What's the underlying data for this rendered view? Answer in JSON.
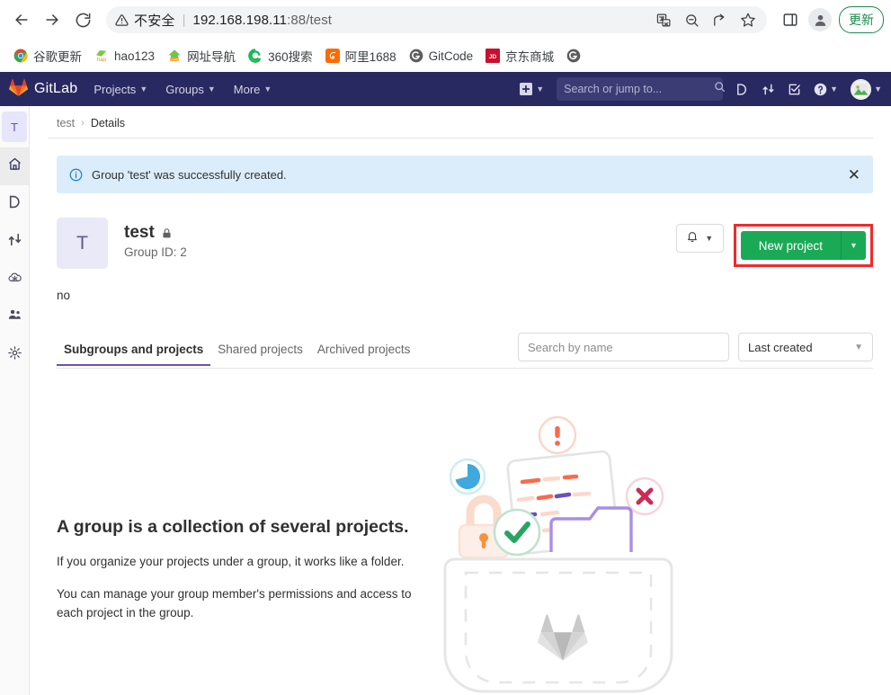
{
  "browser": {
    "nav": {
      "back_icon": "arrow-left-icon",
      "forward_icon": "arrow-right-icon",
      "reload_icon": "reload-icon"
    },
    "omnibox": {
      "warning_label": "不安全",
      "separator": "|",
      "url_host": "192.168.198.11",
      "url_rest": ":88/test",
      "translate_icon": "translate-icon",
      "zoom_icon": "zoom-out-icon",
      "share_icon": "share-icon",
      "bookmark_icon": "star-icon"
    },
    "side_panel_icon": "side-panel-icon",
    "profile_icon": "profile-avatar-icon",
    "update_button": "更新",
    "bookmarks": [
      {
        "label": "谷歌更新",
        "icon": "chrome-icon"
      },
      {
        "label": "hao123",
        "icon": "hao123-icon"
      },
      {
        "label": "网址导航",
        "icon": "2345-nav-icon"
      },
      {
        "label": "360搜索",
        "icon": "360-search-icon"
      },
      {
        "label": "阿里1688",
        "icon": "alibaba-1688-icon"
      },
      {
        "label": "GitCode",
        "icon": "gitcode-icon"
      },
      {
        "label": "京东商城",
        "icon": "jd-icon"
      },
      {
        "label": "",
        "icon": "globe-icon"
      }
    ]
  },
  "gitlab_nav": {
    "brand": "GitLab",
    "menu": [
      {
        "label": "Projects"
      },
      {
        "label": "Groups"
      },
      {
        "label": "More"
      }
    ],
    "search_placeholder": "Search or jump to...",
    "icons": {
      "plus": "plus-square-icon",
      "issues": "issues-icon",
      "merge_requests": "merge-request-icon",
      "todos": "todo-checkbox-icon",
      "help": "help-circle-icon",
      "avatar": "user-avatar-icon"
    }
  },
  "rail": {
    "avatar_letter": "T",
    "items": [
      {
        "name": "group-overview",
        "icon": "home-icon",
        "active": true
      },
      {
        "name": "issues",
        "icon": "issues-icon",
        "active": false
      },
      {
        "name": "merge-requests",
        "icon": "merge-request-icon",
        "active": false
      },
      {
        "name": "kubernetes",
        "icon": "cloud-gear-icon",
        "active": false
      },
      {
        "name": "members",
        "icon": "people-icon",
        "active": false
      },
      {
        "name": "settings",
        "icon": "gear-icon",
        "active": false
      }
    ]
  },
  "breadcrumb": {
    "root": "test",
    "separator": "›",
    "current": "Details"
  },
  "alert": {
    "message": "Group 'test' was successfully created.",
    "close_label": "✕",
    "bg_color": "#dbedfb",
    "icon_color": "#1f78d1"
  },
  "group": {
    "avatar_letter": "T",
    "name": "test",
    "visibility_icon": "lock-icon",
    "id_label": "Group ID: 2",
    "description": "no",
    "notification_icon": "bell-icon",
    "new_project_label": "New project",
    "new_project_color": "#1aaa55",
    "highlight_color": "#f02a2a"
  },
  "tabs": [
    {
      "label": "Subgroups and projects",
      "active": true
    },
    {
      "label": "Shared projects",
      "active": false
    },
    {
      "label": "Archived projects",
      "active": false
    }
  ],
  "filters": {
    "search_placeholder": "Search by name",
    "search_value": "",
    "sort_value": "Last created"
  },
  "empty_state": {
    "title": "A group is a collection of several projects.",
    "paragraph_1": "If you organize your projects under a group, it works like a folder.",
    "paragraph_2": "You can manage your group member's permissions and access to each project in the group.",
    "illustration_name": "group-empty-state-illustration"
  }
}
